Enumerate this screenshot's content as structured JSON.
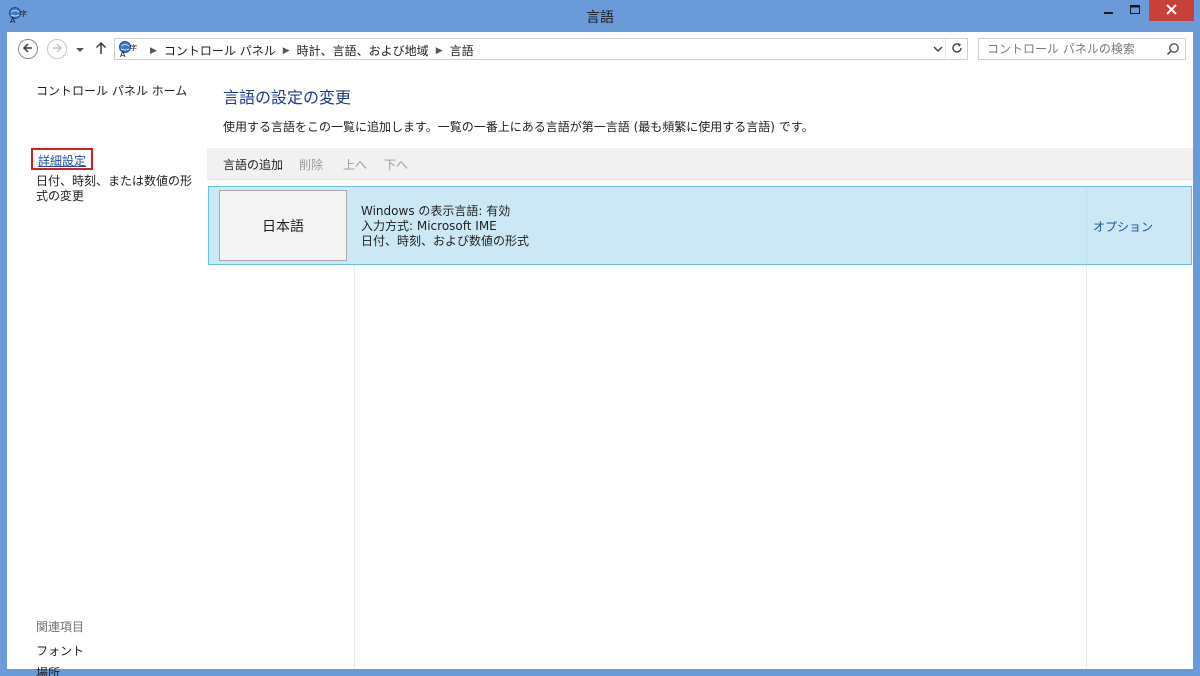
{
  "window": {
    "title": "言語",
    "icon": "language-region-icon",
    "controls": [
      "minimize-icon",
      "maximize-icon",
      "close-icon"
    ]
  },
  "nav": {
    "breadcrumb": [
      "コントロール パネル",
      "時計、言語、および地域",
      "言語"
    ],
    "search_placeholder": "コントロール パネルの検索"
  },
  "sidebar": {
    "home": "コントロール パネル ホーム",
    "advanced": "詳細設定",
    "date_format": "日付、時刻、または数値の形式の変更",
    "related_header": "関連項目",
    "fonts": "フォント",
    "location": "場所"
  },
  "main": {
    "heading": "言語の設定の変更",
    "description": "使用する言語をこの一覧に追加します。一覧の一番上にある言語が第一言語 (最も頻繁に使用する言語) です。",
    "toolbar": {
      "add": "言語の追加",
      "remove": "削除",
      "up": "上へ",
      "down": "下へ"
    },
    "languages": [
      {
        "name": "日本語",
        "details": [
          "Windows の表示言語: 有効",
          "入力方式: Microsoft IME",
          "日付、時刻、および数値の形式"
        ],
        "option": "オプション"
      }
    ]
  },
  "colors": {
    "title_bar": "#6a9bd8",
    "close_button": "#c7413a",
    "heading": "#1e3a8a",
    "link": "#1c4f9f",
    "selected_row": "#cde8f5",
    "highlight_box": "#d0211a"
  }
}
